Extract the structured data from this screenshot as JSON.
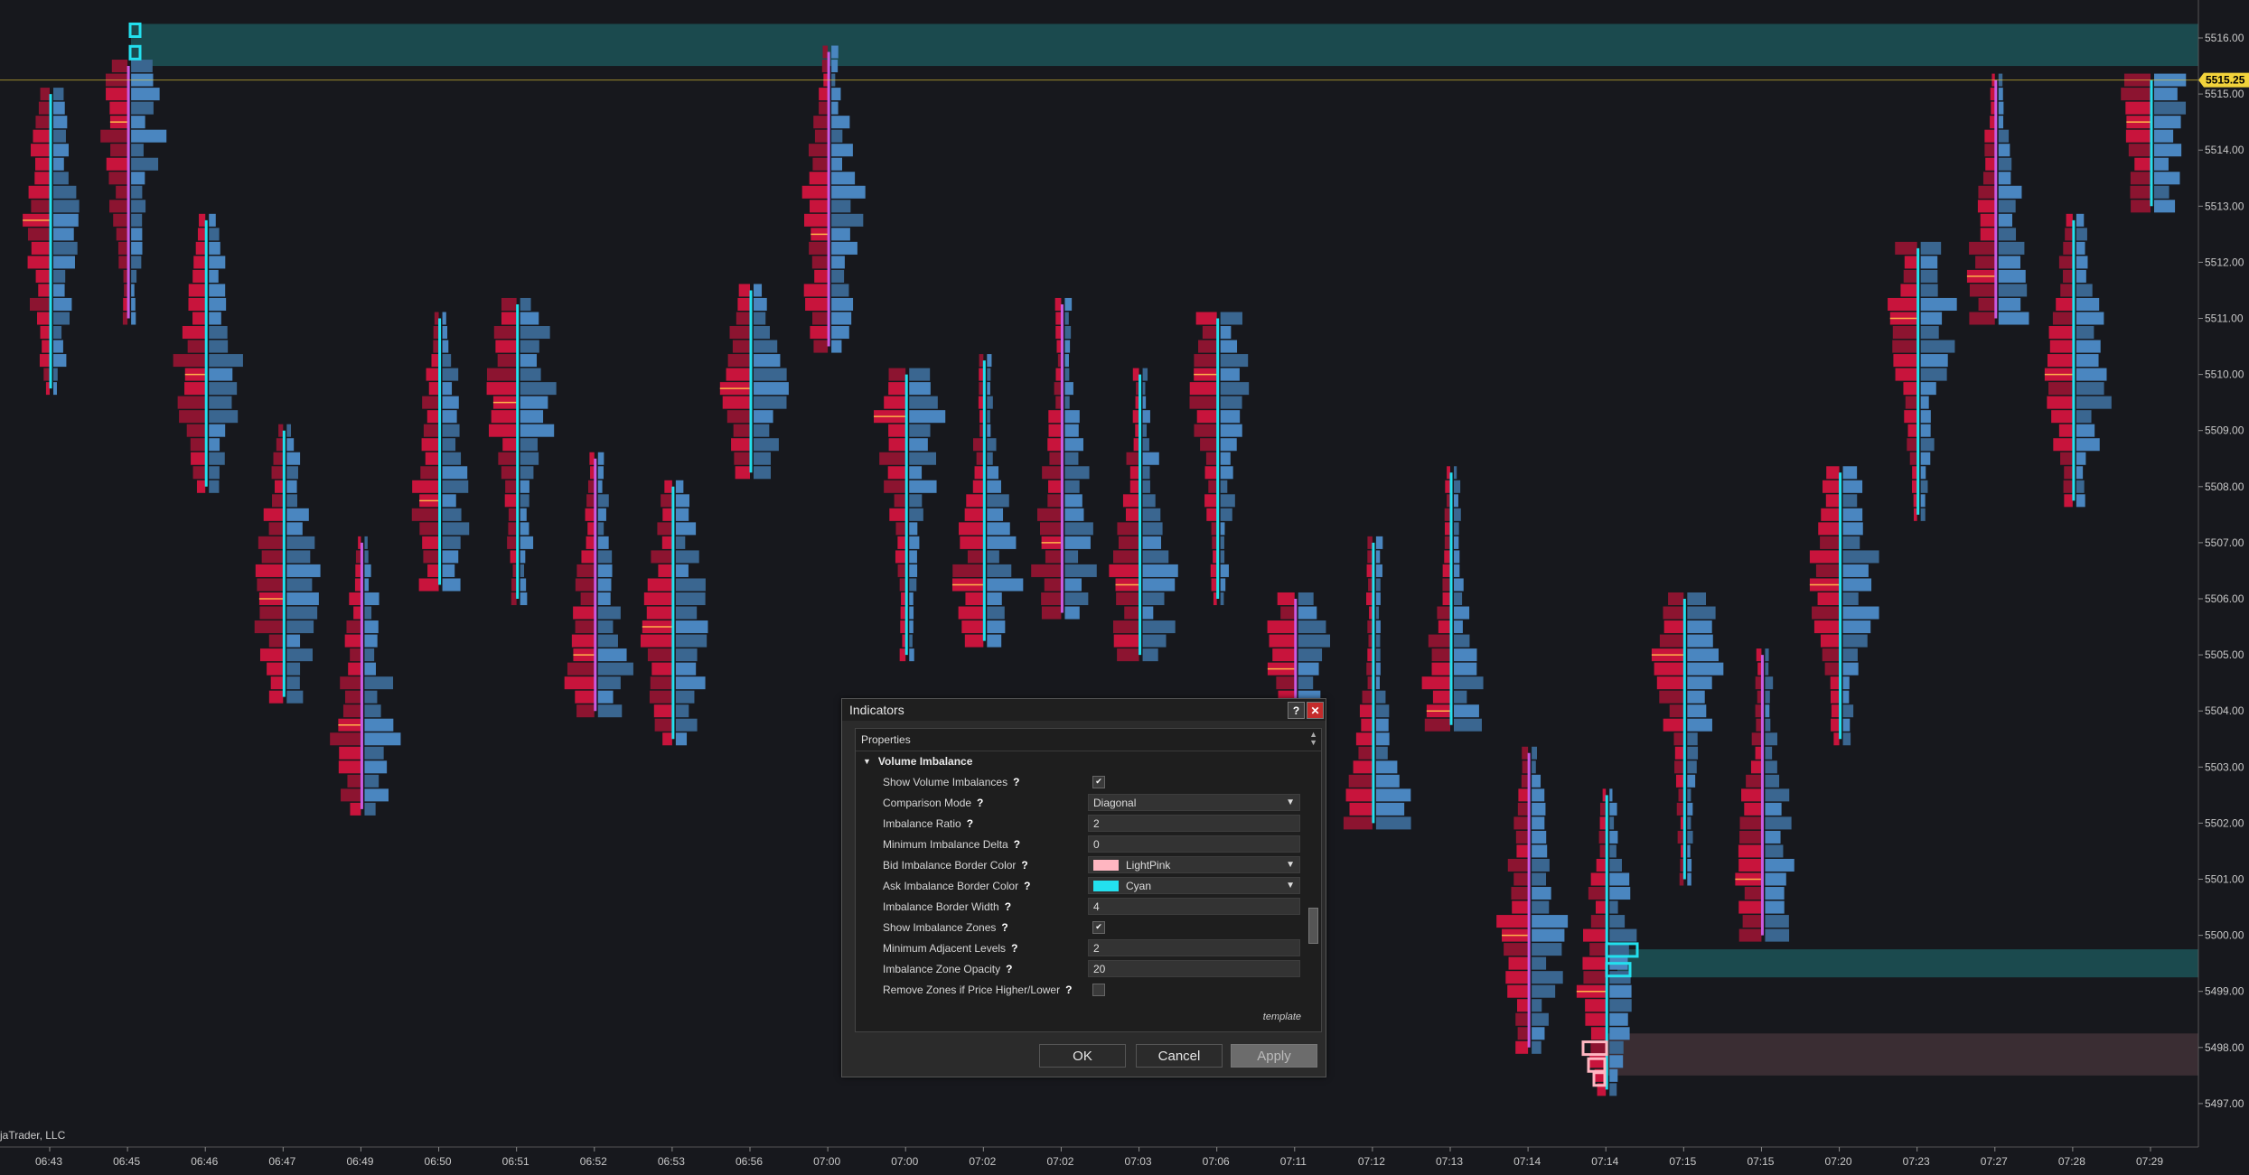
{
  "app": {
    "copyright": "jaTrader, LLC"
  },
  "colors": {
    "background": "#17181d",
    "bid": "#c8143c",
    "bid_dark": "#8c1430",
    "ask": "#4a86c0",
    "ask_dark": "#3a6690",
    "ask_imbalance_zone": "#1b4a4e",
    "bid_imbalance_zone": "#3a2d33",
    "cyan": "#23e0ee",
    "light_pink": "#ffb6c1",
    "last_price": "#f2d33b"
  },
  "price_axis": {
    "labels": [
      "5516.00",
      "5515.00",
      "5514.00",
      "5513.00",
      "5512.00",
      "5511.00",
      "5510.00",
      "5509.00",
      "5508.00",
      "5507.00",
      "5506.00",
      "5505.00",
      "5504.00",
      "5503.00",
      "5502.00",
      "5501.00",
      "5500.00",
      "5499.00",
      "5498.00",
      "5497.00"
    ],
    "last_price": "5515.25"
  },
  "time_axis": {
    "labels": [
      "06:43",
      "06:45",
      "06:46",
      "06:47",
      "06:49",
      "06:50",
      "06:51",
      "06:52",
      "06:53",
      "06:56",
      "07:00",
      "07:00",
      "07:02",
      "07:02",
      "07:03",
      "07:06",
      "07:11",
      "07:12",
      "07:13",
      "07:14",
      "07:14",
      "07:15",
      "07:15",
      "07:20",
      "07:23",
      "07:27",
      "07:28",
      "07:29"
    ]
  },
  "chart_data": {
    "type": "footprint",
    "price_range": [
      5496.5,
      5516.5
    ],
    "bars": [
      {
        "time": "06:43",
        "low": 5509.75,
        "high": 5515.0,
        "poc": 5512.75
      },
      {
        "time": "06:45",
        "low": 5511.0,
        "high": 5515.5,
        "poc": 5514.5
      },
      {
        "time": "06:46",
        "low": 5508.0,
        "high": 5512.75,
        "poc": 5510.0
      },
      {
        "time": "06:47",
        "low": 5504.25,
        "high": 5509.0,
        "poc": 5506.0
      },
      {
        "time": "06:49",
        "low": 5502.25,
        "high": 5507.0,
        "poc": 5503.75
      },
      {
        "time": "06:50",
        "low": 5506.25,
        "high": 5511.0,
        "poc": 5507.75
      },
      {
        "time": "06:51",
        "low": 5506.0,
        "high": 5511.25,
        "poc": 5509.5
      },
      {
        "time": "06:52",
        "low": 5504.0,
        "high": 5508.5,
        "poc": 5505.0
      },
      {
        "time": "06:53",
        "low": 5503.5,
        "high": 5508.0,
        "poc": 5505.5
      },
      {
        "time": "06:56",
        "low": 5508.25,
        "high": 5511.5,
        "poc": 5509.75
      },
      {
        "time": "07:00",
        "low": 5510.5,
        "high": 5515.75,
        "poc": 5512.5
      },
      {
        "time": "07:00",
        "low": 5505.0,
        "high": 5510.0,
        "poc": 5509.25
      },
      {
        "time": "07:02",
        "low": 5505.25,
        "high": 5510.25,
        "poc": 5506.25
      },
      {
        "time": "07:02",
        "low": 5505.75,
        "high": 5511.25,
        "poc": 5507.0
      },
      {
        "time": "07:03",
        "low": 5505.0,
        "high": 5510.0,
        "poc": 5506.25
      },
      {
        "time": "07:06",
        "low": 5506.0,
        "high": 5511.0,
        "poc": 5510.0
      },
      {
        "time": "07:11",
        "low": 5503.5,
        "high": 5506.0,
        "poc": 5504.75
      },
      {
        "time": "07:12",
        "low": 5502.0,
        "high": 5507.0,
        "poc": 5501.75
      },
      {
        "time": "07:13",
        "low": 5503.75,
        "high": 5508.25,
        "poc": 5504.0
      },
      {
        "time": "07:14",
        "low": 5498.0,
        "high": 5503.25,
        "poc": 5500.0
      },
      {
        "time": "07:14",
        "low": 5497.25,
        "high": 5502.5,
        "poc": 5499.0
      },
      {
        "time": "07:15",
        "low": 5501.0,
        "high": 5506.0,
        "poc": 5505.0
      },
      {
        "time": "07:15",
        "low": 5500.0,
        "high": 5505.0,
        "poc": 5501.0
      },
      {
        "time": "07:20",
        "low": 5503.5,
        "high": 5508.25,
        "poc": 5506.25
      },
      {
        "time": "07:23",
        "low": 5507.5,
        "high": 5512.25,
        "poc": 5511.0
      },
      {
        "time": "07:27",
        "low": 5511.0,
        "high": 5515.25,
        "poc": 5511.75
      },
      {
        "time": "07:28",
        "low": 5507.75,
        "high": 5512.75,
        "poc": 5510.0
      },
      {
        "time": "07:29",
        "low": 5513.0,
        "high": 5515.25,
        "poc": 5514.5
      }
    ],
    "ask_zones": [
      [
        5515.5,
        5516.25
      ],
      [
        5499.25,
        5499.75
      ]
    ],
    "bid_zones": [
      [
        5497.5,
        5498.25
      ]
    ]
  },
  "dialog": {
    "title": "Indicators",
    "help_label": "?",
    "close_label": "✕",
    "panel_header": "Properties",
    "section": "Volume Imbalance",
    "show_volume_imbalances": {
      "label": "Show Volume Imbalances",
      "checked": "✔"
    },
    "comparison_mode": {
      "label": "Comparison Mode",
      "value": "Diagonal"
    },
    "imbalance_ratio": {
      "label": "Imbalance Ratio",
      "value": "2"
    },
    "min_imbalance_delta": {
      "label": "Minimum Imbalance Delta",
      "value": "0"
    },
    "bid_border_color": {
      "label": "Bid Imbalance Border Color",
      "value": "LightPink"
    },
    "ask_border_color": {
      "label": "Ask Imbalance Border Color",
      "value": "Cyan"
    },
    "border_width": {
      "label": "Imbalance Border Width",
      "value": "4"
    },
    "show_zones": {
      "label": "Show Imbalance Zones",
      "checked": "✔"
    },
    "min_adjacent_levels": {
      "label": "Minimum Adjacent Levels",
      "value": "2"
    },
    "zone_opacity": {
      "label": "Imbalance Zone Opacity",
      "value": "20"
    },
    "remove_zones": {
      "label": "Remove Zones if Price Higher/Lower",
      "checked": ""
    },
    "help_mark": "?",
    "template": "template",
    "ok": "OK",
    "cancel": "Cancel",
    "apply": "Apply"
  }
}
